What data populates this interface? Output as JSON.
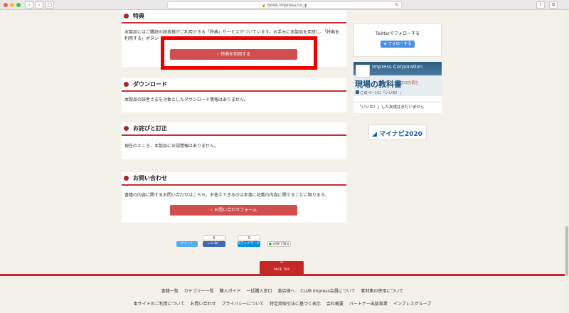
{
  "browser": {
    "url": "book.impress.co.jp",
    "back_glyph": "‹",
    "forward_glyph": "›",
    "sidebar_glyph": "▢",
    "reload_glyph": "↻",
    "share_glyph": "⇧",
    "tabs_glyph": "⧉"
  },
  "sections": {
    "tokuten": {
      "title": "特典",
      "text": "本製品にはご購読の読者様がご利用できる「特典」サービスがついています。お手元に本製品を用意し、「特典を利用する」ボタン",
      "button": "特典を利用する"
    },
    "download": {
      "title": "ダウンロード",
      "text": "本製品の読者さまを対象としたダウンロード情報はありません。"
    },
    "owabi": {
      "title": "お詫びと訂正",
      "text": "現在のところ、本製品に正誤情報はありません。"
    },
    "contact": {
      "title": "お問い合わせ",
      "text": "書籍の内容に関するお問い合わせはこちら。お答えできるのは本書に記載の内容に関することに限ります。",
      "button": "お問い合わせフォーム"
    }
  },
  "sidebar": {
    "twitter_label": "Twitterでフォローする",
    "twitter_button": "フォローする",
    "fb_name": "Impress Corporation",
    "fb_big_text": "現場の教科書",
    "fb_sub": "150万再生",
    "fb_like_line": "このページに「いいね！」",
    "fb_note": "「いいね！」した友達はまだいません",
    "mynavi": "マイナビ2020"
  },
  "share": {
    "tweet": "ツイート",
    "like_count": "0",
    "like": "いいね！",
    "hatena_count": "0",
    "hatena": "Bブックマーク",
    "line": "LINEで送る"
  },
  "footer": {
    "page_top": "PAGE TOP",
    "row1": [
      "書籍一覧",
      "カテゴリー一覧",
      "購入ガイド",
      "一括購入窓口",
      "書店様へ",
      "CLUB Impress会員について",
      "素材集の使用について"
    ],
    "row2": [
      "本サイトのご利用について",
      "お問い合わせ",
      "プライバシーについて",
      "特定商取引法に基づく表示",
      "会社概要",
      "パートナー出版事業",
      "インプレスグループ"
    ]
  },
  "colors": {
    "accent": "#c62828",
    "button": "#d04e4e",
    "highlight": "#ee0000",
    "twitter": "#4a90e2"
  }
}
